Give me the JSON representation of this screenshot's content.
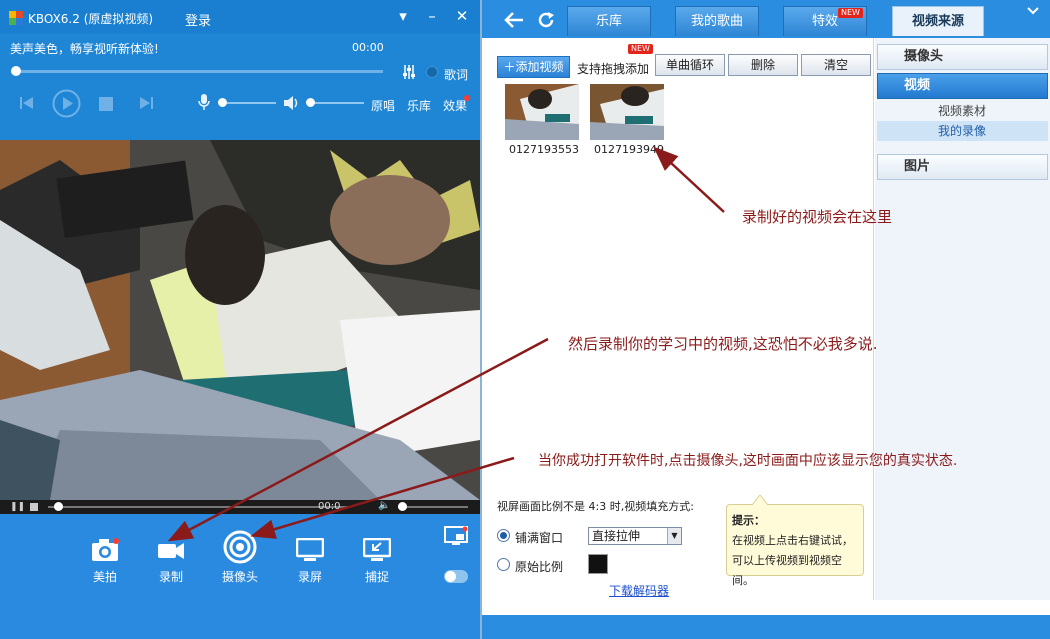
{
  "window": {
    "title": "KBOX6.2 (原虚拟视频)",
    "login": "登录",
    "minimize_icon": "minimize-icon",
    "close_icon": "close-icon"
  },
  "player": {
    "song_title": "美声美色，畅享视听新体验!",
    "time": "00:00",
    "lyrics_label": "歌词",
    "links": {
      "original": "原唱",
      "library": "乐库",
      "effects": "效果"
    }
  },
  "video_bar": {
    "time": "00:0"
  },
  "tools": [
    {
      "label": "美拍",
      "icon": "camera-icon"
    },
    {
      "label": "录制",
      "icon": "video-record-icon"
    },
    {
      "label": "摄像头",
      "icon": "webcam-icon"
    },
    {
      "label": "录屏",
      "icon": "screen-record-icon"
    },
    {
      "label": "捕捉",
      "icon": "capture-icon"
    }
  ],
  "nav": {
    "tabs": [
      {
        "label": "乐库",
        "active": false
      },
      {
        "label": "我的歌曲",
        "active": false
      },
      {
        "label": "特效",
        "active": false,
        "badge": "NEW"
      },
      {
        "label": "视频来源",
        "active": true
      }
    ]
  },
  "toolbar": {
    "add_video": "添加视频",
    "drag_hint": "支持拖拽添加",
    "drag_badge": "NEW",
    "loop": "单曲循环",
    "delete": "删除",
    "clear": "清空"
  },
  "videos": [
    {
      "name": "0127193553"
    },
    {
      "name": "0127193949"
    }
  ],
  "settings": {
    "aspect_label": "视屏画面比例不是 4:3 时,视频填充方式:",
    "fill_window": "铺满窗口",
    "original_ratio": "原始比例",
    "stretch_option": "直接拉伸",
    "download_decoder": "下载解码器"
  },
  "tip": {
    "title": "提示：",
    "line1": "在视频上点击右键试试，",
    "line2": "可以上传视频到视频空间。"
  },
  "sidebar": {
    "camera": "摄像头",
    "video": "视频",
    "video_material": "视频素材",
    "my_recordings": "我的录像",
    "pictures": "图片"
  },
  "annotations": {
    "recorded_here": "录制好的视频会在这里",
    "record_study": "然后录制你的学习中的视频,这恐怕不必我多说.",
    "open_software": "当你成功打开软件时,点击摄像头,这时画面中应该显示您的真实状态."
  },
  "colors": {
    "accent_blue": "#2b8de0",
    "annotation": "#8b1a1a",
    "badge_red": "#e3241b"
  }
}
